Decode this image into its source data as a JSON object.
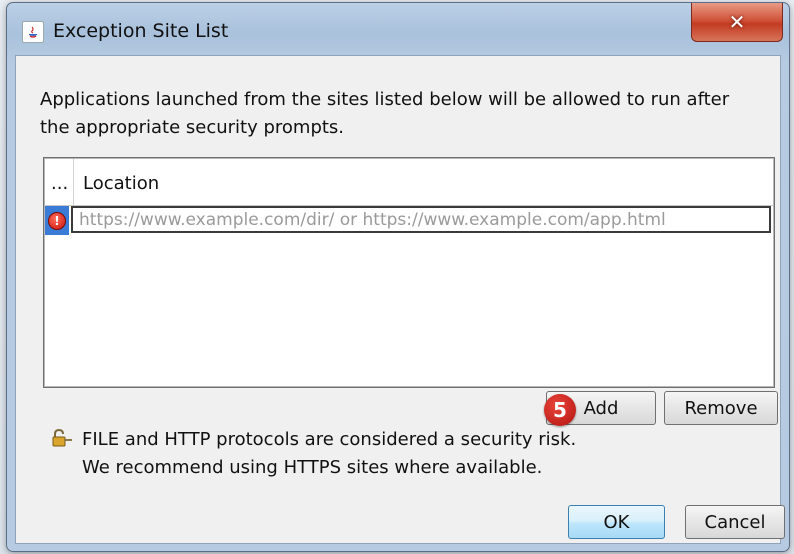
{
  "window": {
    "title": "Exception Site List"
  },
  "dialog": {
    "description": "Applications launched from the sites listed below will be allowed to run after the appropriate security prompts.",
    "table": {
      "header_ellipsis": "...",
      "header_location": "Location",
      "rows": [
        {
          "status_icon": "error-icon",
          "location_value": "",
          "location_placeholder": "https://www.example.com/dir/ or https://www.example.com/app.html"
        }
      ]
    },
    "add_label": "Add",
    "remove_label": "Remove",
    "step_badge": "5",
    "warning_line1": "FILE and HTTP protocols are considered a security risk.",
    "warning_line2": "We recommend using HTTPS sites where available.",
    "ok_label": "OK",
    "cancel_label": "Cancel"
  },
  "colors": {
    "selection": "#3a7bd5",
    "close_button": "#c23b22",
    "default_button": "#bee6fd",
    "badge": "#c8140a"
  }
}
